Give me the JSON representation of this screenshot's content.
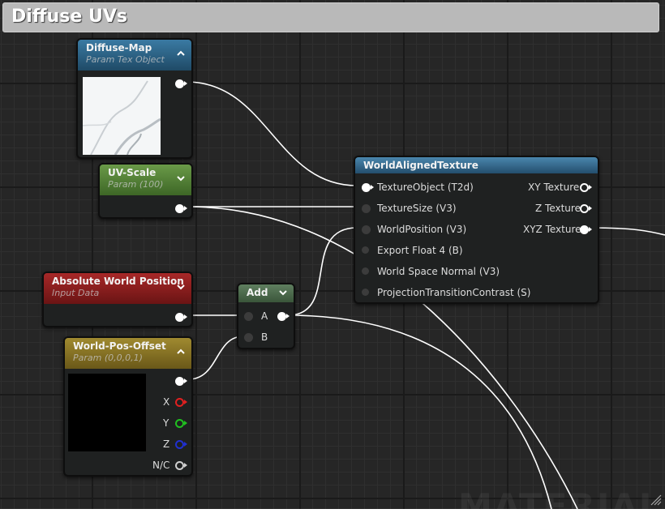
{
  "comment": {
    "title": "Diffuse UVs"
  },
  "nodes": {
    "diffuse_map": {
      "title": "Diffuse-Map",
      "subtitle": "Param Tex Object"
    },
    "uv_scale": {
      "title": "UV-Scale",
      "subtitle": "Param (100)"
    },
    "abs_world_pos": {
      "title": "Absolute World Position",
      "subtitle": "Input Data"
    },
    "world_pos_offset": {
      "title": "World-Pos-Offset",
      "subtitle": "Param (0,0,0,1)",
      "outputs": [
        "X",
        "Y",
        "Z",
        "N/C"
      ]
    },
    "add": {
      "title": "Add",
      "inputs": [
        "A",
        "B"
      ]
    },
    "world_aligned_texture": {
      "title": "WorldAlignedTexture",
      "inputs": [
        "TextureObject (T2d)",
        "TextureSize (V3)",
        "WorldPosition (V3)",
        "Export Float 4 (B)",
        "World Space Normal (V3)",
        "ProjectionTransitionContrast (S)"
      ],
      "outputs": [
        "XY Texture",
        "Z Texture",
        "XYZ Texture"
      ]
    }
  },
  "watermark": "MATERIAL",
  "colors": {
    "texture_header": "#2f6e95",
    "param_header": "#5a8a3a",
    "input_header": "#8e1f1f",
    "vector_param_header": "#8a7628",
    "math_header": "#4f6b4f",
    "function_header": "#3a6e93",
    "pin_x": "#e02020",
    "pin_y": "#20c020",
    "pin_z": "#2030d0"
  }
}
